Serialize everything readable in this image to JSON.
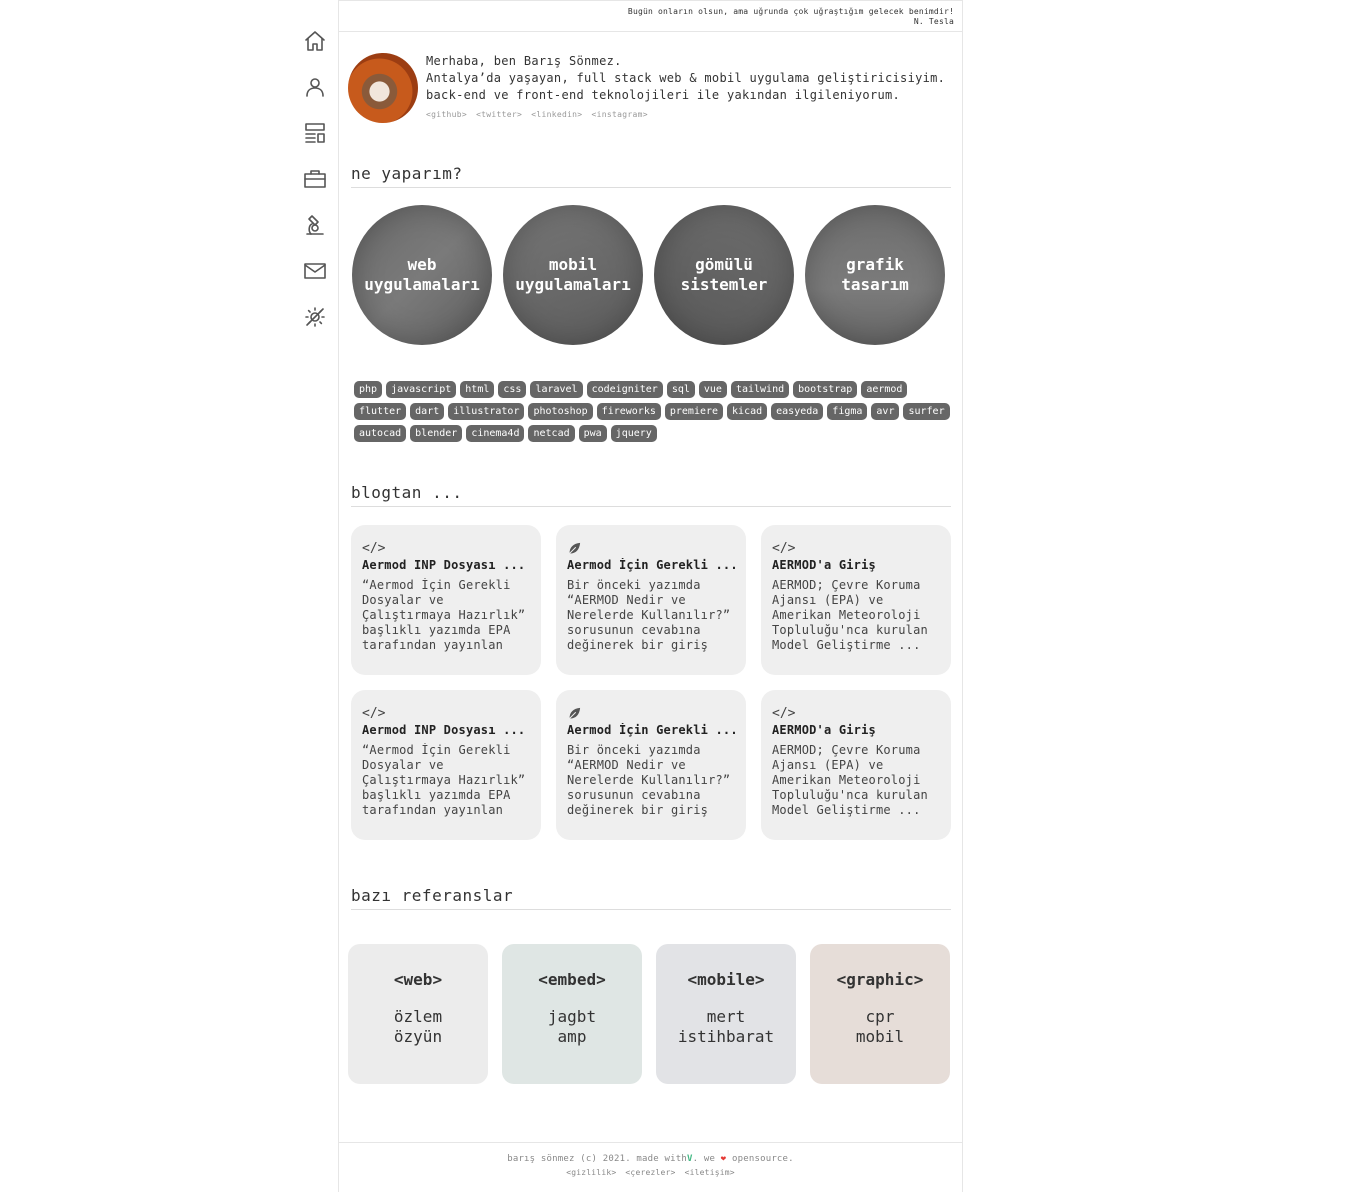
{
  "quote": {
    "text": "Bugün onların olsun, ama uğrunda çok uğraştığım gelecek benimdir!",
    "author": "N. Tesla"
  },
  "sidebar": {
    "items": [
      {
        "name": "home",
        "icon": "home-icon"
      },
      {
        "name": "about",
        "icon": "user-icon"
      },
      {
        "name": "blog",
        "icon": "layout-icon"
      },
      {
        "name": "portfolio",
        "icon": "briefcase-icon"
      },
      {
        "name": "lab",
        "icon": "microscope-icon"
      },
      {
        "name": "contact",
        "icon": "mail-icon"
      },
      {
        "name": "theme",
        "icon": "theme-toggle-icon"
      }
    ]
  },
  "intro": {
    "line1": "Merhaba, ben Barış Sönmez.",
    "line2": "Antalya’da yaşayan, full stack web & mobil uygulama geliştiricisiyim.",
    "line3": "back-end ve front-end teknolojileri ile yakından ilgileniyorum.",
    "links": [
      "<github>",
      "<twitter>",
      "<linkedin>",
      "<instagram>"
    ]
  },
  "services": {
    "heading": "ne yaparım?",
    "items": [
      {
        "line1": "web",
        "line2": "uygulamaları"
      },
      {
        "line1": "mobil",
        "line2": "uygulamaları"
      },
      {
        "line1": "gömülü",
        "line2": "sistemler"
      },
      {
        "line1": "grafik",
        "line2": "tasarım"
      }
    ]
  },
  "tags": [
    "php",
    "javascript",
    "html",
    "css",
    "laravel",
    "codeigniter",
    "sql",
    "vue",
    "tailwind",
    "bootstrap",
    "aermod",
    "flutter",
    "dart",
    "illustrator",
    "photoshop",
    "fireworks",
    "premiere",
    "kicad",
    "easyeda",
    "figma",
    "avr",
    "surfer",
    "autocad",
    "blender",
    "cinema4d",
    "netcad",
    "pwa",
    "jquery"
  ],
  "blog": {
    "heading": "blogtan ...",
    "posts": [
      {
        "icon": "code-icon",
        "icon_text": "</>",
        "title": "Aermod INP Dosyası ...",
        "excerpt": "“Aermod İçin Gerekli Dosyalar ve Çalıştırmaya Hazırlık” başlıklı yazımda EPA tarafından yayınlan ..."
      },
      {
        "icon": "leaf-icon",
        "icon_text": "",
        "title": "Aermod İçin Gerekli ...",
        "excerpt": "Bir önceki yazımda “AERMOD Nedir ve Nerelerde Kullanılır?” sorusunun cevabına değinerek bir giriş ..."
      },
      {
        "icon": "code-icon",
        "icon_text": "</>",
        "title": "AERMOD'a Giriş",
        "excerpt": "AERMOD; Çevre Koruma Ajansı (EPA) ve Amerikan Meteoroloji Topluluğu'nca kurulan Model Geliştirme ..."
      },
      {
        "icon": "code-icon",
        "icon_text": "</>",
        "title": "Aermod INP Dosyası ...",
        "excerpt": "“Aermod İçin Gerekli Dosyalar ve Çalıştırmaya Hazırlık” başlıklı yazımda EPA tarafından yayınlan ..."
      },
      {
        "icon": "leaf-icon",
        "icon_text": "",
        "title": "Aermod İçin Gerekli ...",
        "excerpt": "Bir önceki yazımda “AERMOD Nedir ve Nerelerde Kullanılır?” sorusunun cevabına değinerek bir giriş ..."
      },
      {
        "icon": "code-icon",
        "icon_text": "</>",
        "title": "AERMOD'a Giriş",
        "excerpt": "AERMOD; Çevre Koruma Ajansı (EPA) ve Amerikan Meteoroloji Topluluğu'nca kurulan Model Geliştirme ..."
      }
    ]
  },
  "references": {
    "heading": "bazı referanslar",
    "items": [
      {
        "category": "<web>",
        "line1": "özlem",
        "line2": "özyün"
      },
      {
        "category": "<embed>",
        "line1": "jagbt",
        "line2": "amp"
      },
      {
        "category": "<mobile>",
        "line1": "mert",
        "line2": "istihbarat"
      },
      {
        "category": "<graphic>",
        "line1": "cpr",
        "line2": "mobil"
      }
    ]
  },
  "footer": {
    "prefix": "barış sönmez (c) 2021. made with",
    "vue_mark": "V",
    "middle": ". we",
    "heart": "❤",
    "suffix": "opensource.",
    "links": [
      "<gizlilik>",
      "<çerezler>",
      "<iletişim>"
    ]
  },
  "colors": {
    "accent_vue": "#41b883",
    "heart": "#e53935",
    "tag_bg": "#666666",
    "card_bg": "#efefef"
  }
}
